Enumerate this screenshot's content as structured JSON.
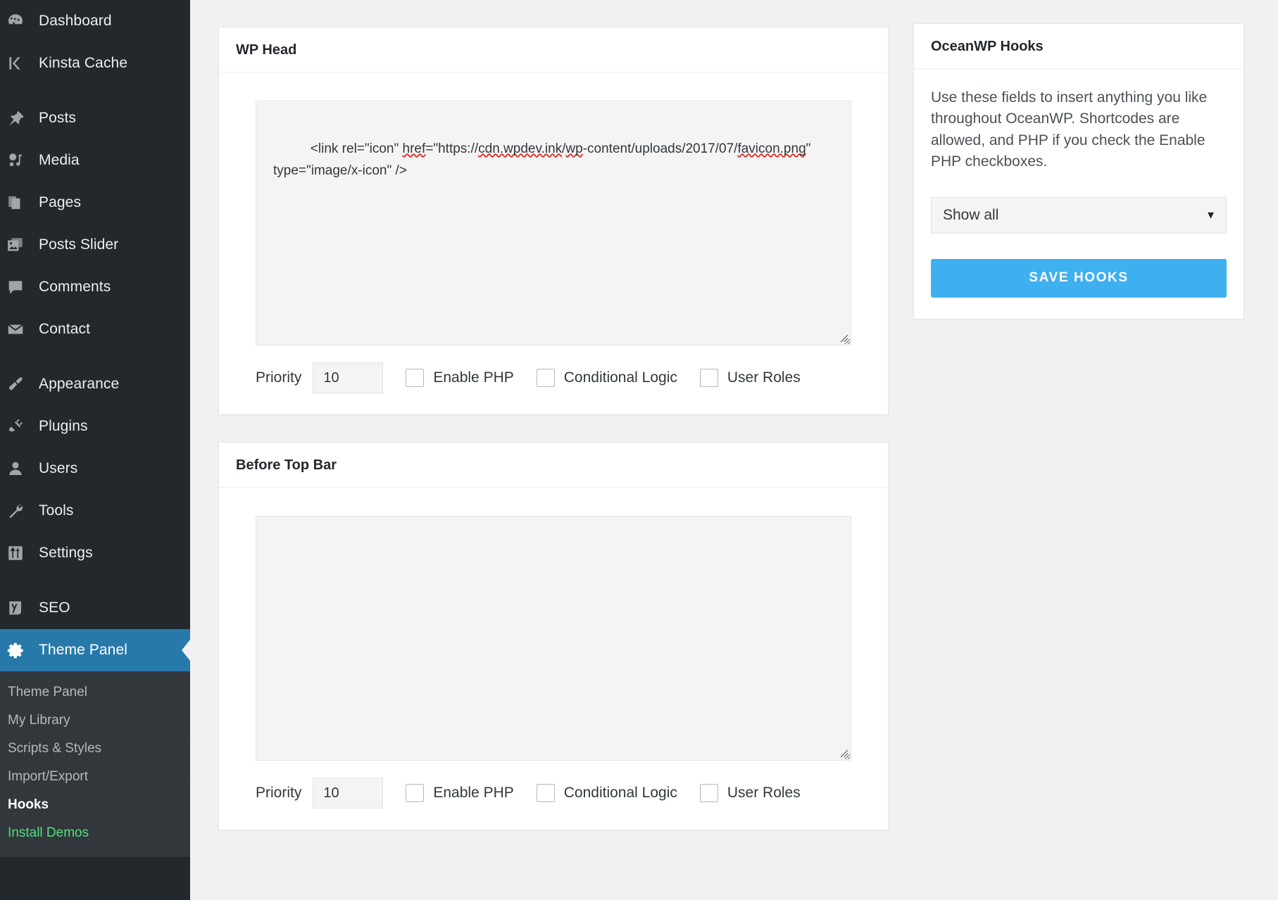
{
  "colors": {
    "sidebar_bg": "#23282d",
    "submenu_bg": "#32373c",
    "active_menu_bg": "#2779aa",
    "content_bg": "#f1f1f1",
    "accent_button": "#3fb0ef",
    "install_demos_green": "#4ee07e",
    "spellcheck_underline": "#e02b20"
  },
  "sidebar": {
    "groups": [
      {
        "items": [
          {
            "label": "Dashboard",
            "icon": "dashboard-icon"
          },
          {
            "label": "Kinsta Cache",
            "icon": "kinsta-k-icon"
          }
        ]
      },
      {
        "items": [
          {
            "label": "Posts",
            "icon": "pin-icon"
          },
          {
            "label": "Media",
            "icon": "media-icon"
          },
          {
            "label": "Pages",
            "icon": "pages-icon"
          },
          {
            "label": "Posts Slider",
            "icon": "slider-images-icon"
          },
          {
            "label": "Comments",
            "icon": "comment-bubble-icon"
          },
          {
            "label": "Contact",
            "icon": "envelope-icon"
          }
        ]
      },
      {
        "items": [
          {
            "label": "Appearance",
            "icon": "paintbrush-icon"
          },
          {
            "label": "Plugins",
            "icon": "plug-icon"
          },
          {
            "label": "Users",
            "icon": "user-icon"
          },
          {
            "label": "Tools",
            "icon": "wrench-icon"
          },
          {
            "label": "Settings",
            "icon": "sliders-icon"
          }
        ]
      },
      {
        "items": [
          {
            "label": "SEO",
            "icon": "yoast-seo-icon"
          }
        ]
      }
    ],
    "active_item": {
      "label": "Theme Panel",
      "icon": "gear-icon"
    },
    "submenu": [
      {
        "label": "Theme Panel",
        "state": "normal"
      },
      {
        "label": "My Library",
        "state": "normal"
      },
      {
        "label": "Scripts & Styles",
        "state": "normal"
      },
      {
        "label": "Import/Export",
        "state": "normal"
      },
      {
        "label": "Hooks",
        "state": "current"
      },
      {
        "label": "Install Demos",
        "state": "green"
      }
    ]
  },
  "hook_boxes": [
    {
      "title": "WP Head",
      "textarea_value": "<link rel=\"icon\" href=\"https://cdn.wpdev.ink/wp-content/uploads/2017/07/favicon.png\" type=\"image/x-icon\" />",
      "textarea_placeholder": "",
      "priority_label": "Priority",
      "priority_value": "10",
      "checkboxes": [
        {
          "label": "Enable PHP",
          "checked": false
        },
        {
          "label": "Conditional Logic",
          "checked": false
        },
        {
          "label": "User Roles",
          "checked": false
        }
      ]
    },
    {
      "title": "Before Top Bar",
      "textarea_value": "",
      "textarea_placeholder": "",
      "priority_label": "Priority",
      "priority_value": "10",
      "checkboxes": [
        {
          "label": "Enable PHP",
          "checked": false
        },
        {
          "label": "Conditional Logic",
          "checked": false
        },
        {
          "label": "User Roles",
          "checked": false
        }
      ]
    }
  ],
  "side_panel": {
    "title": "OceanWP Hooks",
    "description": "Use these fields to insert anything you like throughout OceanWP. Shortcodes are allowed, and PHP if you check the Enable PHP checkboxes.",
    "filter_selected": "Show all",
    "filter_options": [
      "Show all"
    ],
    "caret_glyph": "▼",
    "save_label": "Save Hooks"
  }
}
